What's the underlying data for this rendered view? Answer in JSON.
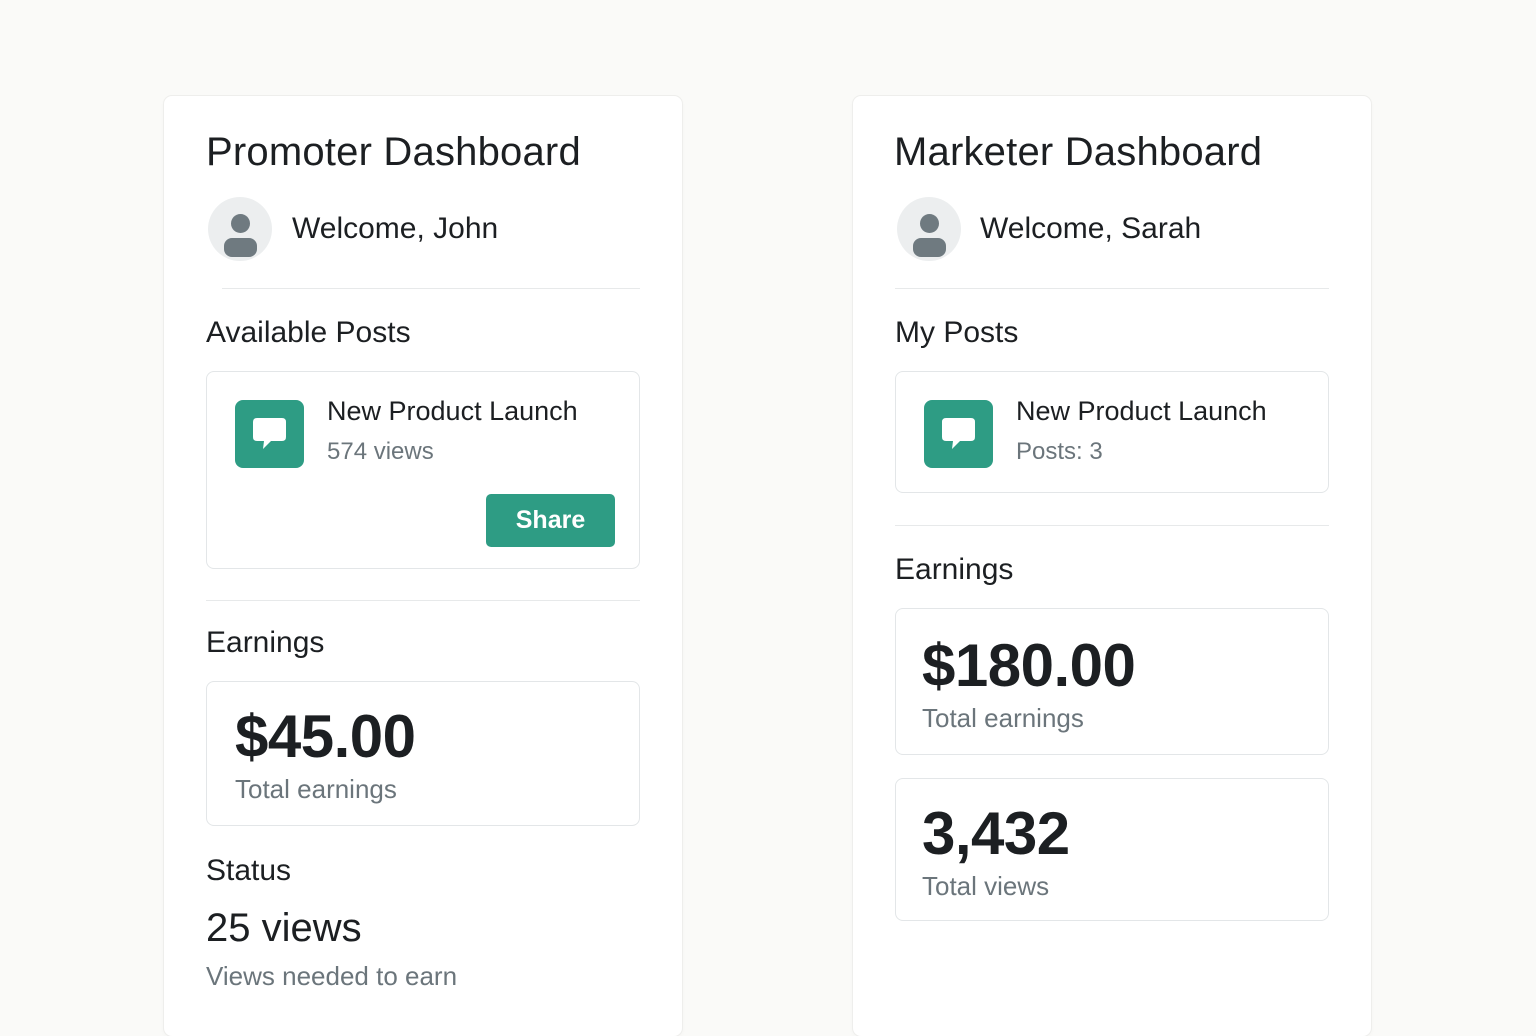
{
  "promoter": {
    "title": "Promoter Dashboard",
    "welcome": "Welcome, John",
    "posts_heading": "Available Posts",
    "post": {
      "icon": "chat-bubble-icon",
      "title": "New Product Launch",
      "subtitle": "574 views",
      "share_label": "Share"
    },
    "earnings_heading": "Earnings",
    "earnings_amount": "$45.00",
    "earnings_caption": "Total earnings",
    "status_heading": "Status",
    "status_value": "25 views",
    "status_caption": "Views needed to earn"
  },
  "marketer": {
    "title": "Marketer Dashboard",
    "welcome": "Welcome, Sarah",
    "posts_heading": "My Posts",
    "post": {
      "icon": "chat-bubble-icon",
      "title": "New Product Launch",
      "subtitle": "Posts: 3"
    },
    "earnings_heading": "Earnings",
    "earnings_amount": "$180.00",
    "earnings_caption": "Total earnings",
    "views_total": "3,432",
    "views_caption": "Total views"
  },
  "colors": {
    "accent": "#2e9c84",
    "background": "#fafaf8",
    "muted_text": "#6b757b"
  }
}
